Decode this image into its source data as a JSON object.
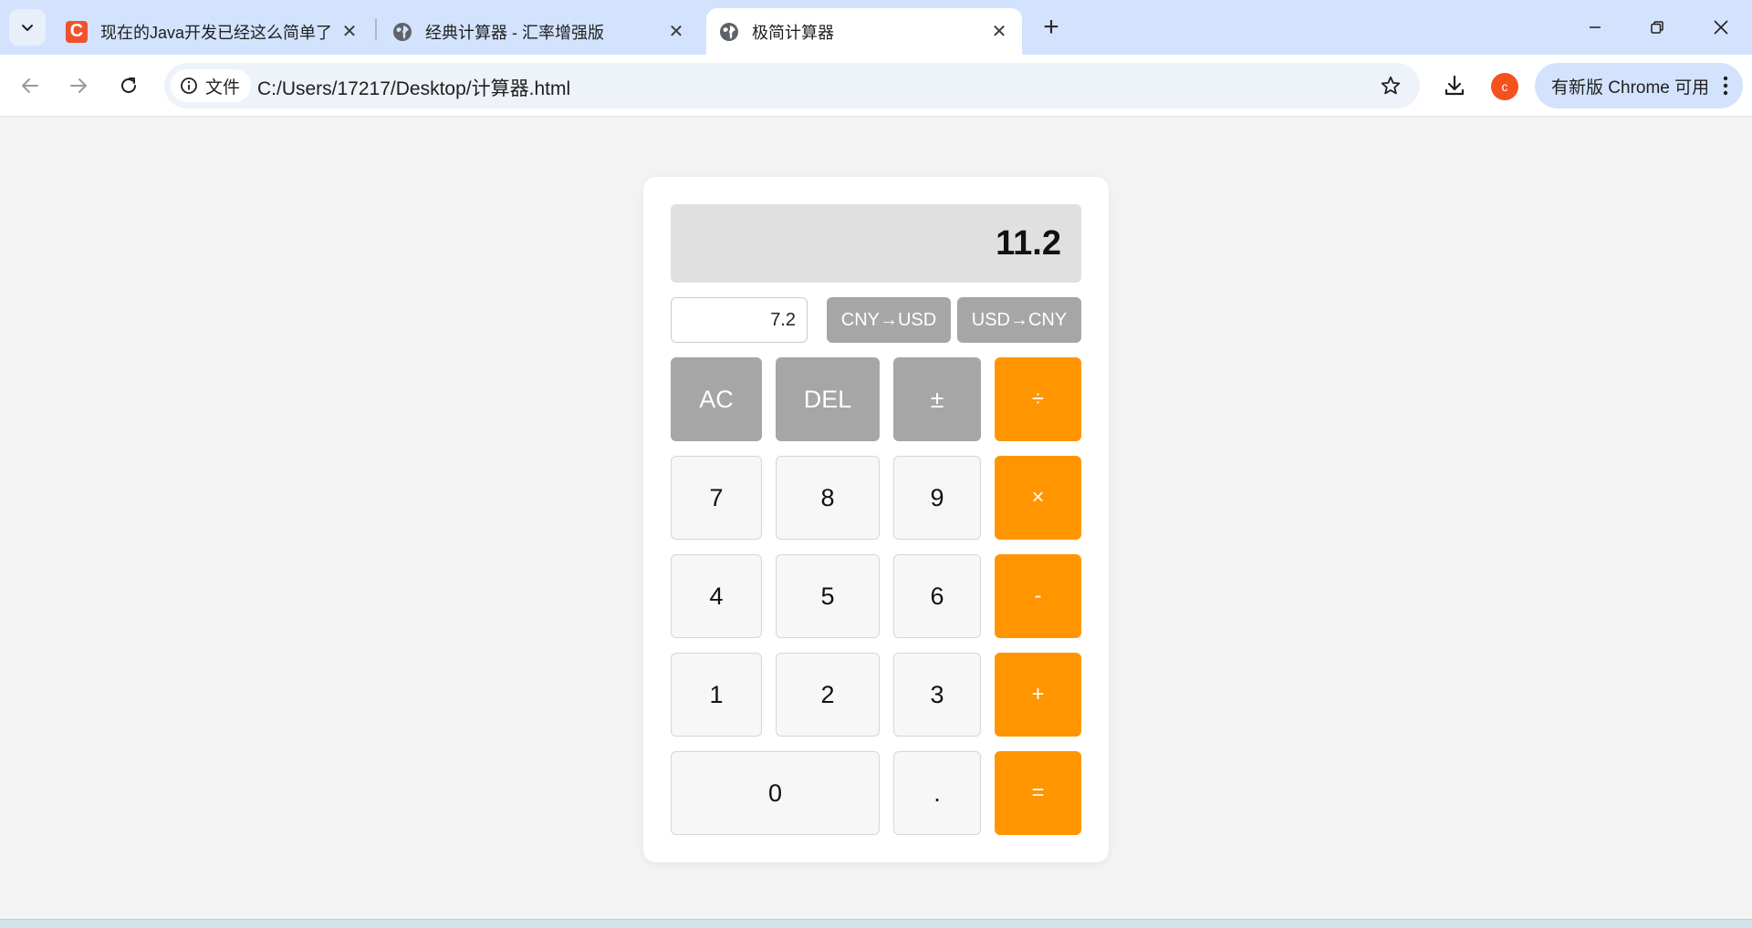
{
  "browser": {
    "tabs": [
      {
        "title": "现在的Java开发已经这么简单了",
        "favicon": "csdn-c-icon",
        "favicon_letter": "C",
        "active": false
      },
      {
        "title": "经典计算器 - 汇率增强版",
        "favicon": "globe-icon",
        "active": false
      },
      {
        "title": "极简计算器",
        "favicon": "globe-icon",
        "active": true
      }
    ],
    "site_chip_label": "文件",
    "url": "C:/Users/17217/Desktop/计算器.html",
    "profile_initial": "c",
    "update_label": "有新版 Chrome 可用",
    "colors": {
      "tabbar": "#d3e3fd",
      "profile": "#f4511e"
    }
  },
  "calculator": {
    "display_value": "11.2",
    "rate_value": "7.2",
    "convert_cny_to_usd": "CNY→USD",
    "convert_usd_to_cny": "USD→CNY",
    "keys": {
      "ac": "AC",
      "del": "DEL",
      "negate": "±",
      "divide": "÷",
      "seven": "7",
      "eight": "8",
      "nine": "9",
      "multiply": "×",
      "four": "4",
      "five": "5",
      "six": "6",
      "subtract": "-",
      "one": "1",
      "two": "2",
      "three": "3",
      "add": "+",
      "zero": "0",
      "decimal": ".",
      "equals": "="
    },
    "colors": {
      "operator": "#ff9500",
      "function": "#a6a6a6",
      "number": "#f7f7f7",
      "display": "#e0e0e0"
    }
  }
}
